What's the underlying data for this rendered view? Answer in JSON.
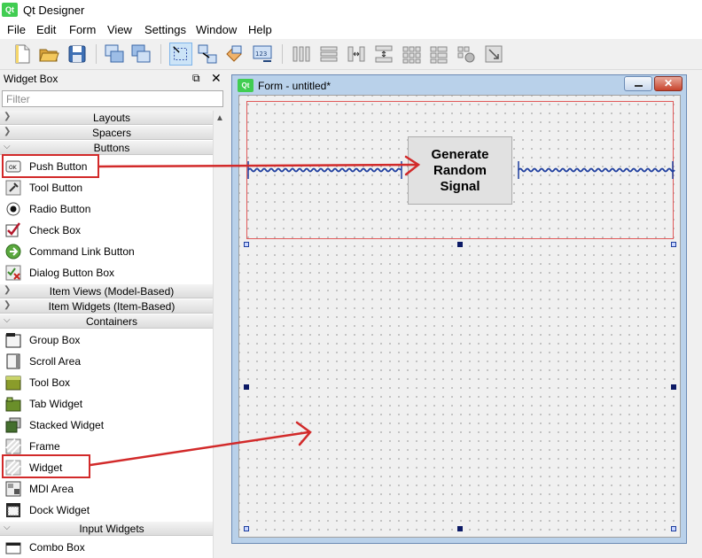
{
  "window": {
    "title": "Qt Designer",
    "app_icon": "Qt"
  },
  "menubar": {
    "items": [
      "File",
      "Edit",
      "Form",
      "View",
      "Settings",
      "Window",
      "Help"
    ]
  },
  "widget_box": {
    "title": "Widget Box",
    "filter_placeholder": "Filter",
    "categories": {
      "layouts": "Layouts",
      "spacers": "Spacers",
      "buttons": "Buttons",
      "item_views": "Item Views (Model-Based)",
      "item_widgets": "Item Widgets (Item-Based)",
      "containers": "Containers",
      "input_widgets": "Input Widgets"
    },
    "buttons": {
      "push_button": "Push Button",
      "tool_button": "Tool Button",
      "radio_button": "Radio Button",
      "check_box": "Check Box",
      "command_link_button": "Command Link Button",
      "dialog_button_box": "Dialog Button Box"
    },
    "containers": {
      "group_box": "Group Box",
      "scroll_area": "Scroll Area",
      "tool_box": "Tool Box",
      "tab_widget": "Tab Widget",
      "stacked_widget": "Stacked Widget",
      "frame": "Frame",
      "widget": "Widget",
      "mdi_area": "MDI Area",
      "dock_widget": "Dock Widget"
    },
    "input_widgets": {
      "combo_box": "Combo Box"
    },
    "push_button_icon_text": "OK"
  },
  "form": {
    "qt_icon": "Qt",
    "title": "Form - untitled*",
    "button_text": "Generate\nRandom\nSignal"
  },
  "colors": {
    "annotation_red": "#d22a2a",
    "qt_green": "#41cd52",
    "spacer_blue": "#1d3d9e"
  }
}
